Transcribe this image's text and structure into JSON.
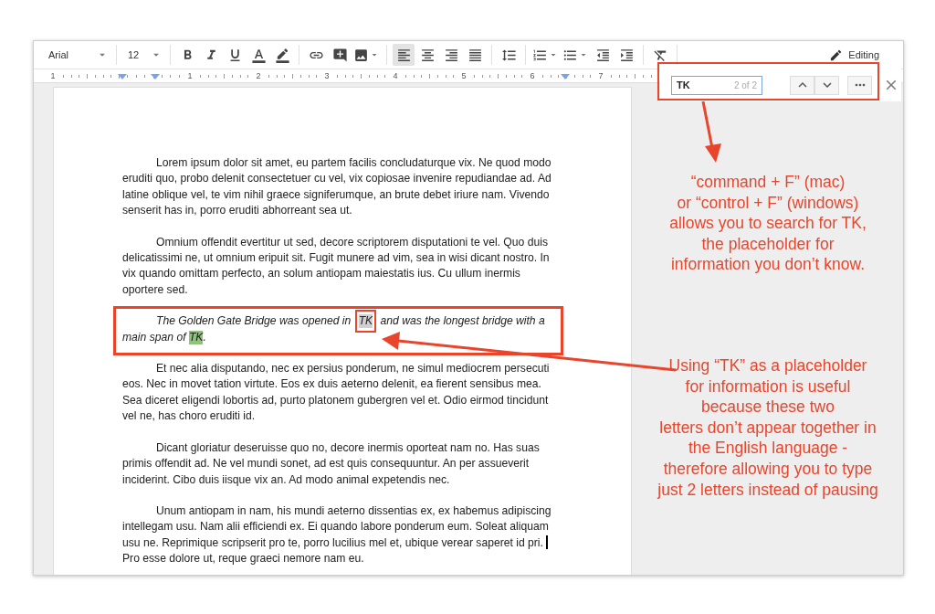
{
  "toolbar": {
    "font": "Arial",
    "size": "12",
    "groups": [
      [
        {
          "kind": "bold"
        },
        {
          "kind": "italic"
        },
        {
          "kind": "underline"
        },
        {
          "kind": "text-color"
        },
        {
          "kind": "highlight"
        }
      ],
      [
        {
          "kind": "link"
        },
        {
          "kind": "comment"
        },
        {
          "kind": "image",
          "menu": true
        }
      ],
      [
        {
          "kind": "align-left",
          "selected": true
        },
        {
          "kind": "align-center",
          "selected": false
        },
        {
          "kind": "align-right",
          "selected": false
        },
        {
          "kind": "align-justify",
          "selected": false
        }
      ],
      [
        {
          "kind": "line-spacing"
        }
      ],
      [
        {
          "kind": "numbered-list",
          "menu": true
        },
        {
          "kind": "bulleted-list",
          "menu": true
        },
        {
          "kind": "indent-less"
        },
        {
          "kind": "indent-more"
        }
      ],
      [
        {
          "kind": "clear-formatting"
        }
      ]
    ],
    "mode": "Editing"
  },
  "ruler": {
    "labels": [
      "1",
      "1",
      "2",
      "3",
      "4",
      "5",
      "6",
      "7"
    ]
  },
  "find": {
    "query": "TK",
    "count": "2 of 2"
  },
  "document": {
    "paragraphs": [
      {
        "kind": "body",
        "annotated": false,
        "parts": [
          {
            "kind": "text",
            "text": "Lorem ipsum dolor sit amet, eu partem facilis concludaturque vix. Ne quod modo eruditi quo, probo delenit consectetuer cu vel, vix copiosae invenire repudiandae ad. Ad latine oblique vel, te vim nihil graece signiferumque, an brute debet iriure nam. Vivendo senserit has in, porro eruditi abhorreant sea ut."
          }
        ]
      },
      {
        "kind": "body",
        "annotated": false,
        "parts": [
          {
            "kind": "text",
            "text": "Omnium offendit evertitur ut sed, decore scriptorem disputationi te vel. Quo duis delicatissimi ne, ut omnium eripuit sit. Fugit munere ad vim, sea in wisi dicant nostro. In vix quando omittam perfecto, an solum antiopam maiestatis ius. Cu ullum inermis oportere sed."
          }
        ]
      },
      {
        "kind": "example",
        "annotated": true,
        "parts": [
          {
            "kind": "text",
            "text": "The Golden Gate Bridge was opened in "
          },
          {
            "kind": "match",
            "text": "TK",
            "current": false,
            "annotated": true
          },
          {
            "kind": "text",
            "text": " and was the longest bridge with a main span of "
          },
          {
            "kind": "match",
            "text": "TK",
            "current": true,
            "annotated": false
          },
          {
            "kind": "text",
            "text": "."
          }
        ]
      },
      {
        "kind": "body",
        "annotated": false,
        "parts": [
          {
            "kind": "text",
            "text": "Et nec alia disputando, nec ex persius ponderum, ne simul mediocrem persecuti eos. Nec in movet tation virtute. Eos ex duis aeterno delenit, ea fierent sensibus mea. Sea diceret eligendi lobortis ad, purto platonem gubergren vel et. Odio eirmod tincidunt vel ne, has choro eruditi id."
          }
        ]
      },
      {
        "kind": "body",
        "annotated": false,
        "parts": [
          {
            "kind": "text",
            "text": "Dicant gloriatur deseruisse quo no, decore inermis oporteat nam no. Has suas primis offendit ad. Ne vel mundi sonet, ad est quis consequuntur. An per assueverit inciderint. Cibo duis iisque vix an. Ad modo animal expetendis nec."
          }
        ]
      },
      {
        "kind": "body",
        "annotated": false,
        "parts": [
          {
            "kind": "text",
            "text": "Unum antiopam in nam, his mundi aeterno dissentias ex, ex habemus adipiscing intellegam usu. Nam alii efficiendi ex. Ei quando labore ponderum eum. Soleat aliquam usu ne. Reprimique scripserit pro te, porro lucilius mel et, ubique verear saperet id pri. "
          },
          {
            "kind": "cursor"
          },
          {
            "kind": "text",
            "text": "Pro esse dolore ut, reque graeci nemore nam eu."
          }
        ]
      }
    ]
  },
  "annotations": [
    {
      "text": "“command + F” (mac)\nor “control + F” (windows)\nallows you to search for TK,\nthe placeholder for\ninformation you don’t know."
    },
    {
      "text": "Using “TK” as a placeholder\nfor information is useful\nbecause these two\nletters don’t appear together in\nthe English language -\ntherefore allowing you to type\njust 2 letters instead of pausing"
    }
  ]
}
